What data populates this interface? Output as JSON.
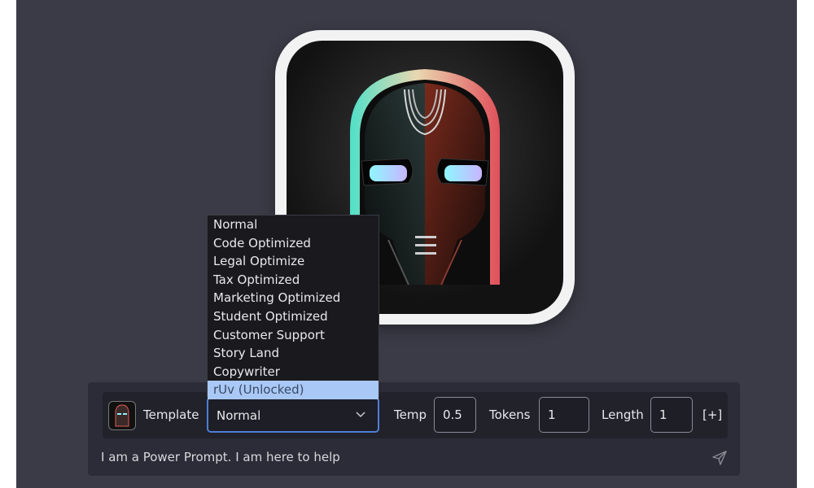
{
  "toolbar": {
    "template_label": "Template",
    "template_selected": "Normal",
    "temp_label": "Temp",
    "temp_value": "0.5",
    "tokens_label": "Tokens",
    "tokens_value": "1",
    "length_label": "Length",
    "length_value": "1",
    "expand_label": "[+]"
  },
  "dropdown": {
    "options": [
      "Normal",
      "Code Optimized",
      "Legal Optimize",
      "Tax Optimized",
      "Marketing Optimized",
      "Student Optimized",
      "Customer Support",
      "Story Land",
      "Copywriter",
      "rUv (Unlocked)"
    ],
    "highlighted_index": 9
  },
  "prompt": {
    "text": "I am a Power Prompt. I am here to help"
  },
  "icons": {
    "logo": "robot-mask-logo-icon",
    "template_thumb": "robot-mask-thumbnail-icon",
    "chevron": "chevron-down-icon",
    "send": "send-icon"
  },
  "colors": {
    "background": "#3b3b47",
    "panel": "#2c2c38",
    "toolbar": "#22222b",
    "accent_border": "#4d7fd6",
    "highlight": "#a9c8f5"
  }
}
